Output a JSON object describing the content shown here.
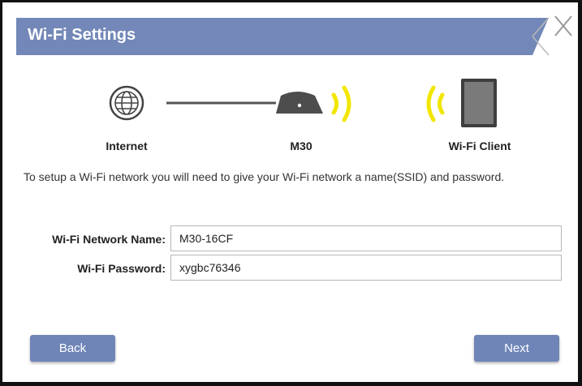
{
  "header": {
    "title": "Wi-Fi Settings"
  },
  "close_icon": "close-icon",
  "diagram": {
    "internet_label": "Internet",
    "device_label": "M30",
    "client_label": "Wi-Fi Client",
    "icons": [
      "globe-icon",
      "router-icon",
      "wifi-signal-icon",
      "tablet-icon"
    ],
    "signal_color": "#f2e600"
  },
  "description": "To setup a Wi-Fi network you will need to give your Wi-Fi network a name(SSID) and password.",
  "form": {
    "network_name_label": "Wi-Fi Network Name:",
    "network_name_value": "M30-16CF",
    "password_label": "Wi-Fi Password:",
    "password_value": "xygbc76346"
  },
  "buttons": {
    "back_label": "Back",
    "next_label": "Next"
  },
  "colors": {
    "header": "#7388b8",
    "button": "#6f85b8"
  }
}
